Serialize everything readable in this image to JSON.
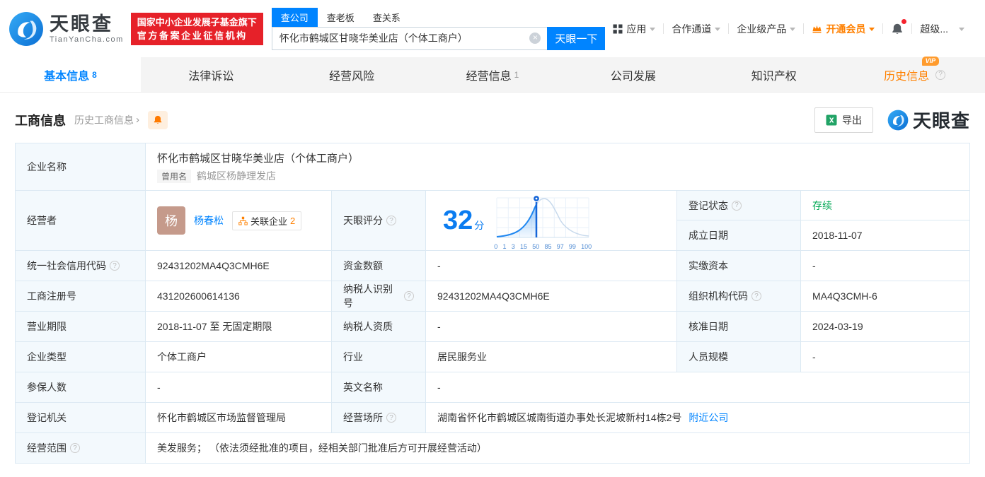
{
  "brand": {
    "logo_text": "天眼查",
    "logo_domain": "TianYanCha.com",
    "badge_line1": "国家中小企业发展子基金旗下",
    "badge_line2": "官方备案企业征信机构"
  },
  "search": {
    "tab_company": "查公司",
    "tab_boss": "查老板",
    "tab_relation": "查关系",
    "value": "怀化市鹤城区甘晓华美业店（个体工商户）",
    "button": "天眼一下"
  },
  "top_nav": {
    "apps": "应用",
    "coop": "合作通道",
    "enterprise": "企业级产品",
    "member": "开通会员",
    "super": "超级..."
  },
  "tabs": [
    {
      "label": "基本信息",
      "count": "8"
    },
    {
      "label": "法律诉讼",
      "count": ""
    },
    {
      "label": "经营风险",
      "count": ""
    },
    {
      "label": "经营信息",
      "count": "1"
    },
    {
      "label": "公司发展",
      "count": ""
    },
    {
      "label": "知识产权",
      "count": ""
    },
    {
      "label": "历史信息",
      "count": "",
      "vip": "VIP"
    }
  ],
  "section": {
    "title": "工商信息",
    "history_link": "历史工商信息",
    "export": "导出",
    "watermark": "天眼查"
  },
  "table": {
    "company_name": {
      "label": "企业名称",
      "value": "怀化市鹤城区甘晓华美业店（个体工商户）",
      "former_tag": "曾用名",
      "former_name": "鹤城区杨静理发店"
    },
    "operator": {
      "label": "经营者",
      "avatar": "杨",
      "name": "杨春松",
      "related_label": "关联企业",
      "related_count": "2"
    },
    "reg_status": {
      "label": "登记状态",
      "value": "存续"
    },
    "est_date": {
      "label": "成立日期",
      "value": "2018-11-07"
    },
    "score": {
      "label": "天眼评分",
      "value": "32",
      "unit": "分"
    },
    "credit_code": {
      "label": "统一社会信用代码",
      "value": "92431202MA4Q3CMH6E"
    },
    "fund_amount": {
      "label": "资金数额",
      "value": "-"
    },
    "paid_capital": {
      "label": "实缴资本",
      "value": "-"
    },
    "reg_no": {
      "label": "工商注册号",
      "value": "431202600614136"
    },
    "taxpayer_no": {
      "label": "纳税人识别号",
      "value": "92431202MA4Q3CMH6E"
    },
    "org_code": {
      "label": "组织机构代码",
      "value": "MA4Q3CMH-6"
    },
    "term": {
      "label": "营业期限",
      "value": "2018-11-07 至 无固定期限"
    },
    "taxpayer_quality": {
      "label": "纳税人资质",
      "value": "-"
    },
    "approve_date": {
      "label": "核准日期",
      "value": "2024-03-19"
    },
    "company_type": {
      "label": "企业类型",
      "value": "个体工商户"
    },
    "industry": {
      "label": "行业",
      "value": "居民服务业"
    },
    "staff_size": {
      "label": "人员规模",
      "value": "-"
    },
    "insured_num": {
      "label": "参保人数",
      "value": "-"
    },
    "english_name": {
      "label": "英文名称",
      "value": "-"
    },
    "reg_authority": {
      "label": "登记机关",
      "value": "怀化市鹤城区市场监督管理局"
    },
    "premises": {
      "label": "经营场所",
      "value": "湖南省怀化市鹤城区城南街道办事处长泥坡新村14栋2号",
      "nearby_link": "附近公司"
    },
    "scope": {
      "label": "经营范围",
      "value": "美发服务； （依法须经批准的项目，经相关部门批准后方可开展经营活动）"
    }
  },
  "score_chart": {
    "type": "line",
    "score": 32,
    "ticks": [
      "0",
      "1",
      "3",
      "15",
      "50",
      "85",
      "97",
      "99",
      "100"
    ],
    "marker_color": "#1565d8",
    "fill_color": "#1e86f0"
  },
  "colors": {
    "primary_blue": "#0084ff",
    "brand_red": "#e62129",
    "orange": "#ff8000",
    "status_green": "#00a854",
    "label_bg": "#f3f9fd",
    "border": "#dce9f3"
  }
}
